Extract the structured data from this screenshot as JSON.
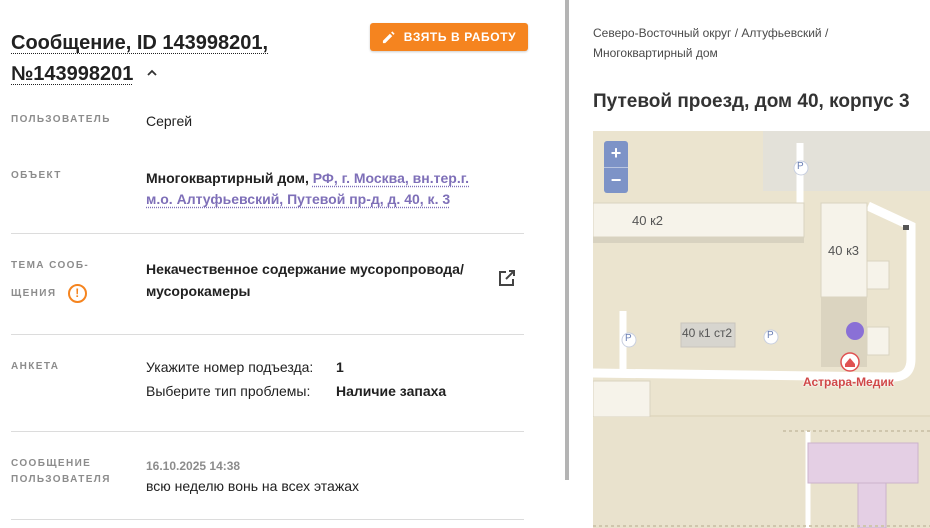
{
  "message": {
    "title": "Сообщение, ID 143998201, №143998201",
    "take_button": "ВЗЯТЬ В РАБОТУ"
  },
  "fields": {
    "user_label": "ПОЛЬЗОВАТЕЛЬ",
    "user_value": "Сергей",
    "object_label": "ОБЪЕКТ",
    "object_type": "Многоквартирный дом,",
    "object_address": "РФ, г. Москва, вн.тер.г. м.о. Алтуфьевский, Путевой пр-д, д. 40, к. 3",
    "topic_label_line1": "ТЕМА СООБ-",
    "topic_label_line2": "ЩЕНИЯ",
    "topic_value": "Некачественное содержание мусоропровода/ мусорокамеры",
    "survey_label": "АНКЕТА",
    "survey_q1": "Укажите номер подъезда:",
    "survey_a1": "1",
    "survey_q2": "Выберите тип проблемы:",
    "survey_a2": "Наличие запаха",
    "user_msg_label_line1": "СООБЩЕНИЕ",
    "user_msg_label_line2": "ПОЛЬЗОВАТЕЛЯ",
    "user_msg_time": "16.10.2025 14:38",
    "user_msg_text": "всю неделю вонь на всех этажах"
  },
  "location": {
    "breadcrumb": "Северо-Восточный округ / Алтуфьевский / Многоквартирный дом",
    "address": "Путевой проезд, дом 40, корпус 3"
  },
  "map": {
    "zoom_in": "+",
    "zoom_out": "−",
    "building_a": "40 к2",
    "building_b": "40 к3",
    "building_c": "40 к1 ст2",
    "parking_1": "P",
    "parking_2": "P",
    "parking_3": "P",
    "poi": "Астрара-Медик"
  },
  "colors": {
    "accent": "#f5841f",
    "link": "#7e6fb8",
    "marker": "#8a70d6"
  },
  "icons": [
    "pencil-icon",
    "chevron-up-icon",
    "warning-icon",
    "external-link-icon"
  ]
}
